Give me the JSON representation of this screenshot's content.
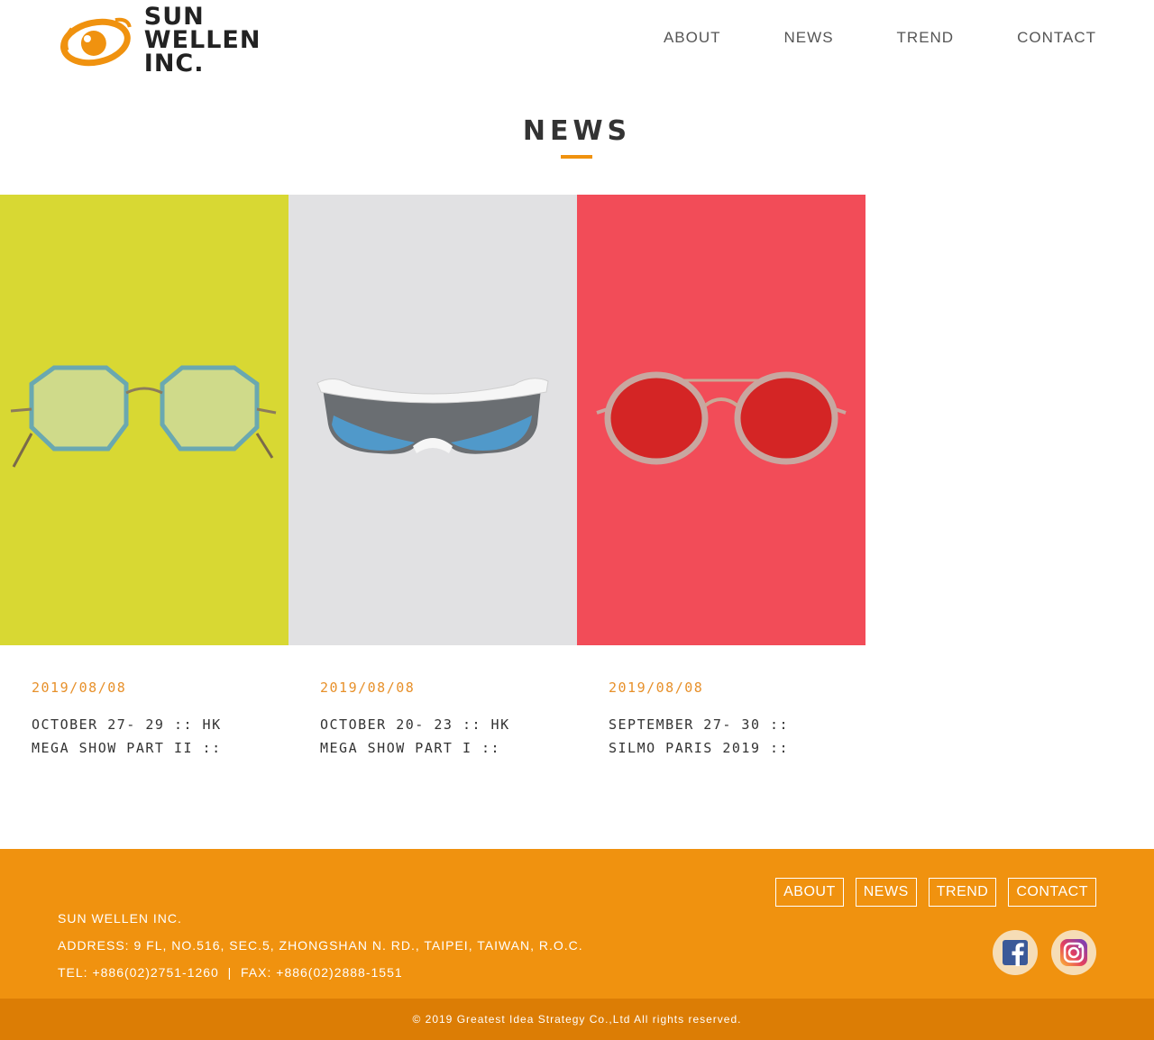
{
  "header": {
    "logo_line1": "SUN",
    "logo_line2": "WELLEN INC.",
    "nav": [
      "ABOUT",
      "NEWS",
      "TREND",
      "CONTACT"
    ]
  },
  "page": {
    "title": "NEWS"
  },
  "news": [
    {
      "date": "2019/08/08",
      "title": "OCTOBER 27- 29 :: HK MEGA SHOW PART II ::",
      "bg_color": "#d8d833",
      "image_icon": "eyeglasses-icon"
    },
    {
      "date": "2019/08/08",
      "title": "OCTOBER 20- 23 :: HK MEGA SHOW PART I ::",
      "bg_color": "#e1e1e3",
      "image_icon": "sport-sunglasses-icon"
    },
    {
      "date": "2019/08/08",
      "title": "SEPTEMBER 27- 30 :: SILMO PARIS 2019 ::",
      "bg_color": "#f24c58",
      "image_icon": "round-sunglasses-icon"
    }
  ],
  "footer": {
    "company": "SUN WELLEN INC.",
    "address": "ADDRESS: 9 FL, NO.516, SEC.5, ZHONGSHAN N. RD., TAIPEI, TAIWAN, R.O.C.",
    "contact": "TEL: +886(02)2751-1260  |  FAX: +886(02)2888-1551",
    "nav": [
      "ABOUT",
      "NEWS",
      "TREND",
      "CONTACT"
    ],
    "social": [
      "facebook-icon",
      "instagram-icon"
    ],
    "copyright": "© 2019 Greatest Idea Strategy Co.,Ltd All rights reserved."
  },
  "colors": {
    "accent": "#f0920f",
    "accent_dark": "#dc7d05",
    "date_text": "#e7902a"
  }
}
